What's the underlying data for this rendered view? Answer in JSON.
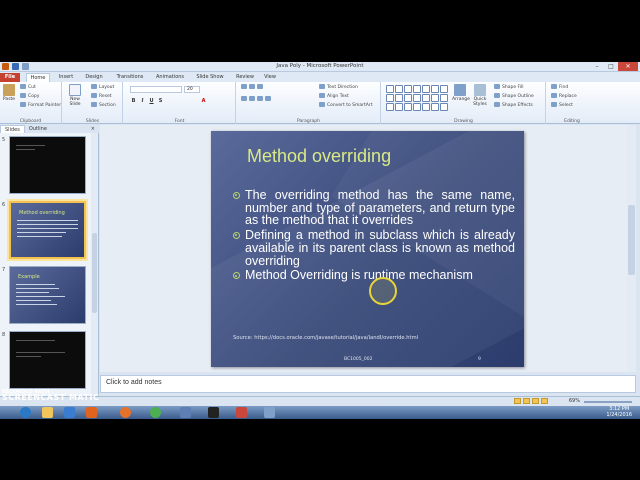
{
  "window": {
    "title": "Java Poly - Microsoft PowerPoint",
    "controls": [
      "–",
      "□",
      "✕"
    ]
  },
  "ribbon_tabs": [
    "File",
    "Home",
    "Insert",
    "Design",
    "Transitions",
    "Animations",
    "Slide Show",
    "Review",
    "View"
  ],
  "ribbon": {
    "clipboard": {
      "paste": "Paste",
      "cut": "Cut",
      "copy": "Copy",
      "format_painter": "Format Painter",
      "label": "Clipboard"
    },
    "slides": {
      "new_slide": "New Slide",
      "layout": "Layout",
      "reset": "Reset",
      "section": "Section",
      "label": "Slides"
    },
    "font": {
      "name": "",
      "size": "20",
      "label": "Font"
    },
    "paragraph": {
      "text_direction": "Text Direction",
      "align_text": "Align Text",
      "smartart": "Convert to SmartArt",
      "label": "Paragraph"
    },
    "drawing": {
      "arrange": "Arrange",
      "quick_styles": "Quick Styles",
      "shape_fill": "Shape Fill",
      "shape_outline": "Shape Outline",
      "shape_effects": "Shape Effects",
      "label": "Drawing"
    },
    "editing": {
      "find": "Find",
      "replace": "Replace",
      "select": "Select",
      "label": "Editing"
    }
  },
  "panel_tabs": {
    "slides": "Slides",
    "outline": "Outline",
    "close": "×"
  },
  "thumbnails": [
    {
      "num": "5",
      "kind": "console"
    },
    {
      "num": "6",
      "kind": "title",
      "title": "Method overriding"
    },
    {
      "num": "7",
      "kind": "title",
      "title": "Example"
    },
    {
      "num": "8",
      "kind": "console"
    }
  ],
  "slide": {
    "title": "Method overriding",
    "bullets": [
      "The overriding method has the same name, number and type of parameters, and return type as the method that it overrides",
      "Defining a method in subclass which is already available in its parent class is known as method overriding",
      "Method Overriding is runtime mechanism"
    ],
    "source": "Source: https://docs.oracle.com/javase/tutorial/java/IandI/override.html",
    "footer": "BC1005_002",
    "number": "9"
  },
  "notes": {
    "placeholder": "Click to add notes"
  },
  "status": {
    "zoom": "69%"
  },
  "watermark": {
    "line1": "RECORDED WITH",
    "line2": "SCREENCAST MATIC"
  },
  "taskbar": {
    "time": "3:12 PM",
    "date": "1/24/2016"
  },
  "colors": {
    "accent": "#d9ea87",
    "bullet": "#b6d66a",
    "file_tab": "#c5402f",
    "slide_bg": "#394a7a"
  }
}
